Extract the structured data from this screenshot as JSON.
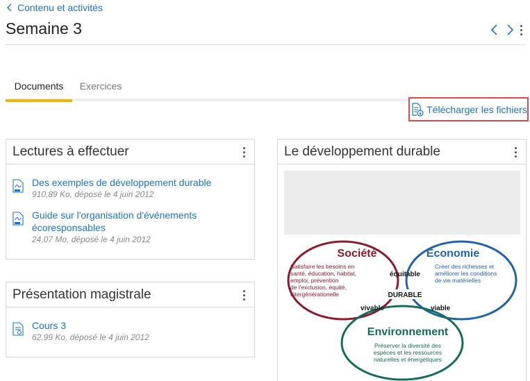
{
  "header": {
    "back_link": "Contenu et activités",
    "title": "Semaine 3"
  },
  "tabs": [
    {
      "label": "Documents",
      "active": true
    },
    {
      "label": "Exercices",
      "active": false
    }
  ],
  "download_button": "Télécharger les fichiers",
  "cards": {
    "lectures": {
      "title": "Lectures à effectuer",
      "items": [
        {
          "title": "Des exemples de développement durable",
          "meta": "910,89 Ko, déposé le 4 juin 2012",
          "icon": "pdf-icon"
        },
        {
          "title_line1": "Guide sur l'organisation d'événements",
          "title_line2": "écoresponsables",
          "meta": "24,07 Mo, déposé le 4 juin 2012",
          "icon": "pdf-icon"
        }
      ]
    },
    "presentation": {
      "title": "Présentation magistrale",
      "items": [
        {
          "title": "Cours 3",
          "meta": "62,99 Ko, déposé le 4 juin 2012",
          "icon": "presentation-file-icon"
        }
      ]
    },
    "dev": {
      "title": "Le développement durable",
      "diagram": {
        "societe": {
          "title": "Société",
          "lines": [
            "Satisfaire les besoins en",
            "santé, éducation, habitat,",
            "emploi, prévention",
            "de l'exclusion, équité,",
            "intergénérationelle"
          ]
        },
        "economie": {
          "title": "Économie",
          "lines": [
            "Créer des richesses et",
            "améliorer les conditions",
            "de vie matérielles"
          ]
        },
        "environnement": {
          "title": "Environnement",
          "lines": [
            "Préserver la diversité des",
            "espèces et les ressources",
            "naturelles et énergétiques"
          ]
        },
        "equitable": "équitable",
        "vivable": "vivable",
        "viable": "viable",
        "durable": "DURABLE"
      }
    }
  },
  "colors": {
    "link": "#1a73c8",
    "tab_accent": "#f2b705",
    "highlight_border": "#e0474c",
    "societe": "#8b1a2b",
    "economie": "#1f63a8",
    "environnement": "#136b5e"
  }
}
